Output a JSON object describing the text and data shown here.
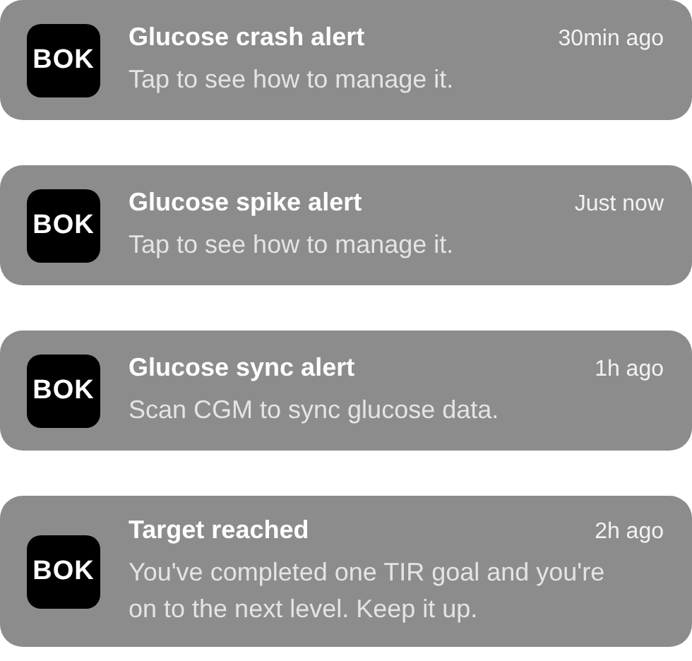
{
  "notifications": [
    {
      "app_logo": "BOK",
      "title": "Glucose crash alert",
      "time": "30min ago",
      "message": "Tap to see how to manage it."
    },
    {
      "app_logo": "BOK",
      "title": "Glucose spike alert",
      "time": "Just now",
      "message": "Tap to see how to manage it."
    },
    {
      "app_logo": "BOK",
      "title": "Glucose sync alert",
      "time": "1h ago",
      "message": "Scan CGM to sync glucose data."
    },
    {
      "app_logo": "BOK",
      "title": "Target reached",
      "time": "2h ago",
      "message": "You've completed one TIR goal and you're on to the next level. Keep it up."
    }
  ]
}
